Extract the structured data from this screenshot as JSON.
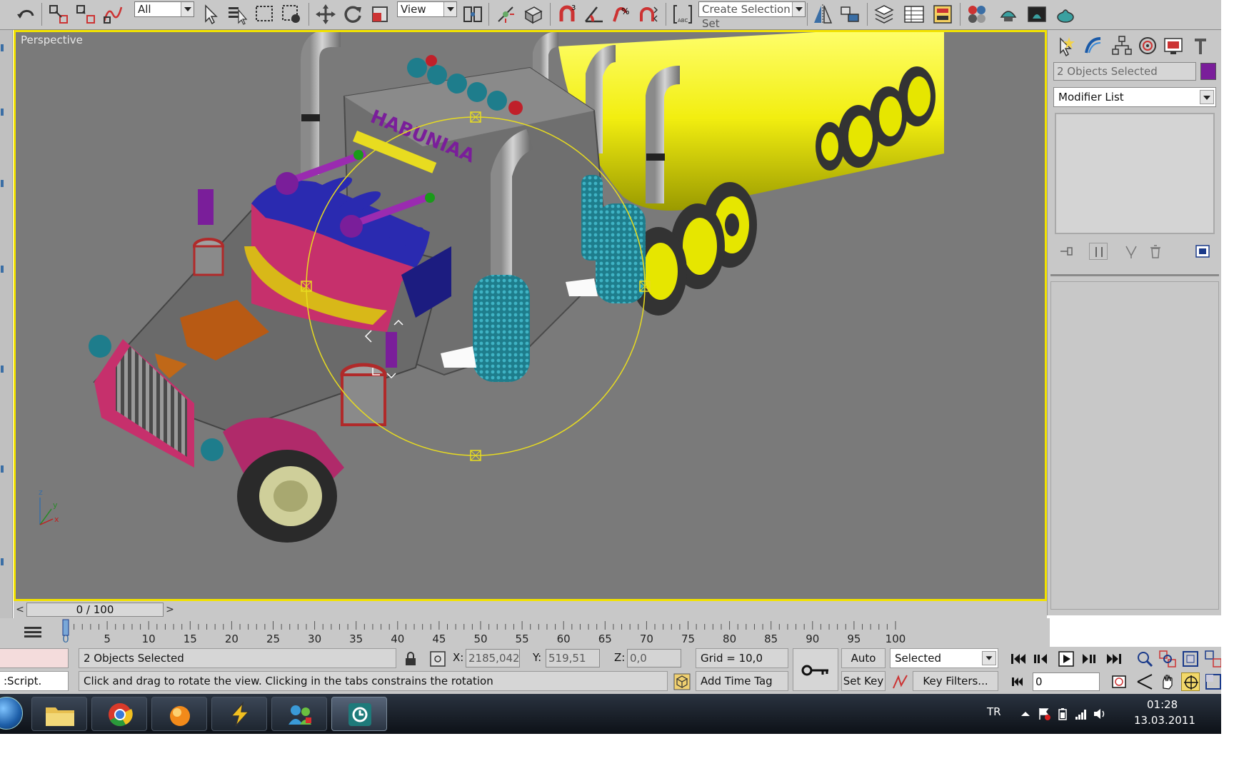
{
  "toolbar": {
    "selection_filter": "All",
    "reference_coordinate": "View",
    "named_selection_placeholder": "Create Selection Set",
    "icons": [
      "undo-icon",
      "select-and-link-icon",
      "unlink-icon",
      "bind-to-space-warp-icon",
      "select-object-icon",
      "select-by-name-icon",
      "rectangular-selection-icon",
      "window-crossing-icon",
      "move-icon",
      "rotate-icon",
      "scale-icon",
      "pivot-icon",
      "manipulate-icon",
      "keyboard-shortcut-icon",
      "snaps-toggle-icon",
      "angle-snap-icon",
      "percent-snap-icon",
      "spinner-snap-icon",
      "edit-named-selections-icon",
      "mirror-icon",
      "align-icon",
      "layer-manager-icon",
      "curve-editor-icon",
      "schematic-view-icon",
      "material-editor-icon",
      "render-setup-icon",
      "rendered-frame-window-icon",
      "render-production-icon"
    ]
  },
  "viewport": {
    "label": "Perspective",
    "truck_text": "HABUNIAA",
    "axis_labels": {
      "x": "x",
      "y": "y",
      "z": "z"
    }
  },
  "time_slider": {
    "current": "0 / 100",
    "prev": "<",
    "next": ">"
  },
  "trackbar": {
    "ticks": [
      "0",
      "5",
      "10",
      "15",
      "20",
      "25",
      "30",
      "35",
      "40",
      "45",
      "50",
      "55",
      "60",
      "65",
      "70",
      "75",
      "80",
      "85",
      "90",
      "95",
      "100"
    ]
  },
  "status": {
    "selection": "2 Objects Selected",
    "prompt": "Click and drag to rotate the view.  Clicking in the tabs constrains the rotation",
    "maxscript": ":Script.",
    "x_label": "X:",
    "x_value": "2185,042",
    "y_label": "Y:",
    "y_value": "519,51",
    "z_label": "Z:",
    "z_value": "0,0",
    "grid": "Grid = 10,0",
    "add_time_tag": "Add Time Tag",
    "auto_key": "Auto Key",
    "set_key": "Set Key",
    "key_mode": "Selected",
    "key_filters": "Key Filters...",
    "frame": "0"
  },
  "command_panel": {
    "object_name": "2 Objects Selected",
    "object_color": "#7a1e9a",
    "modifier_list": "Modifier List",
    "tabs": [
      "create-icon",
      "modify-icon",
      "hierarchy-icon",
      "motion-icon",
      "display-icon",
      "utilities-icon"
    ]
  },
  "taskbar": {
    "apps": [
      "explorer-icon",
      "chrome-icon",
      "media-player-icon",
      "winamp-icon",
      "messenger-icon",
      "3dsmax-icon"
    ],
    "language": "TR",
    "time": "01:28",
    "date": "13.03.2011"
  },
  "colors": {
    "viewport_border": "#f2e200",
    "viewport_bg": "#7a7a7a",
    "ui_gray": "#c8c8c8",
    "taskbar": "#151b23"
  }
}
